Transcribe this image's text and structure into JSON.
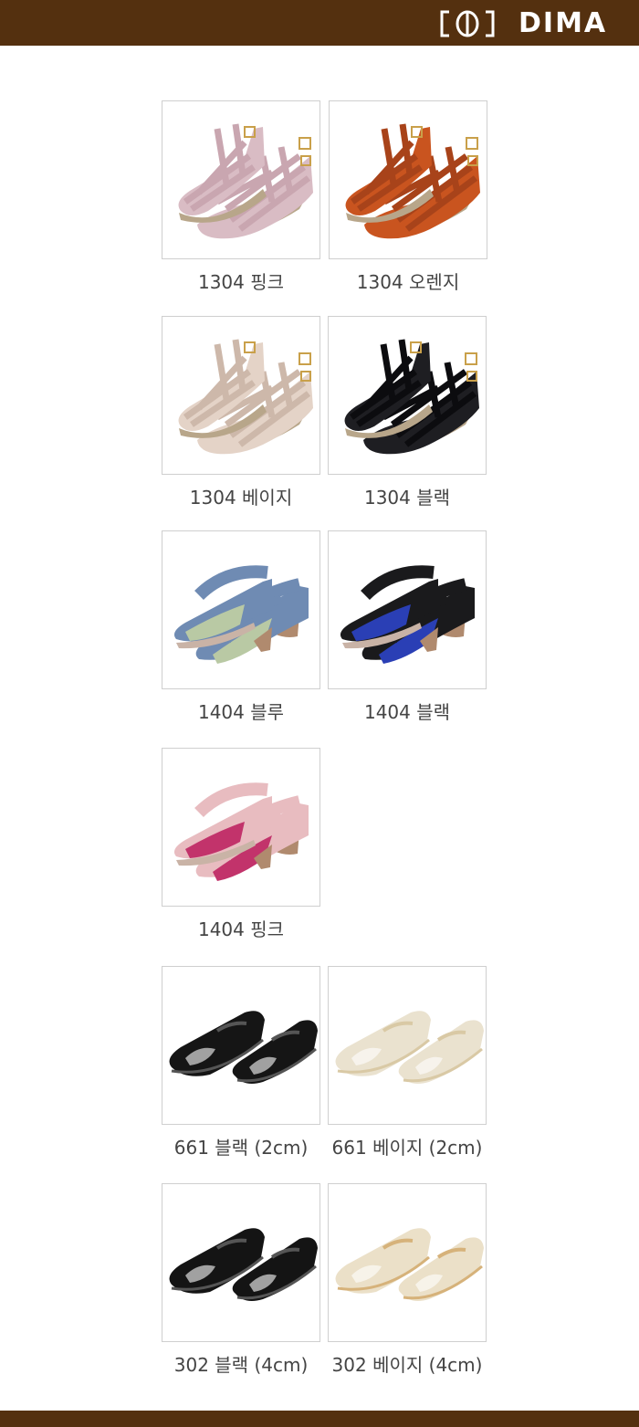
{
  "brand": {
    "name": "DIMA",
    "bar_color": "#54300f"
  },
  "products": [
    {
      "label": "1304 핑크",
      "style": "gladiator",
      "color": "#d9bcc4",
      "accent": "#c9a6b0"
    },
    {
      "label": "1304 오렌지",
      "style": "gladiator",
      "color": "#c9541f",
      "accent": "#a8431a"
    },
    {
      "label": "1304 베이지",
      "style": "gladiator",
      "color": "#e4d3c7",
      "accent": "#cdb8aa"
    },
    {
      "label": "1304 블랙",
      "style": "gladiator",
      "color": "#1e1e22",
      "accent": "#0c0c0f"
    },
    {
      "label": "1404 블루",
      "style": "cross-wedge",
      "color": "#6f8bb3",
      "accent": "#b9c9a4"
    },
    {
      "label": "1404 블랙",
      "style": "cross-wedge",
      "color": "#1a1a1c",
      "accent": "#2a3fb5"
    },
    {
      "label": "1404 핑크",
      "style": "cross-wedge",
      "color": "#e8bcc0",
      "accent": "#c2336b"
    },
    {
      "label": "661 블랙 (2cm)",
      "style": "peep-toe",
      "color": "#151515",
      "accent": "#555555"
    },
    {
      "label": "661 베이지 (2cm)",
      "style": "peep-toe",
      "color": "#eae2cf",
      "accent": "#d9c9a5"
    },
    {
      "label": "302 블랙 (4cm)",
      "style": "peep-toe",
      "color": "#141414",
      "accent": "#555555"
    },
    {
      "label": "302 베이지 (4cm)",
      "style": "peep-toe",
      "color": "#ebe0c8",
      "accent": "#d6b27a"
    }
  ]
}
